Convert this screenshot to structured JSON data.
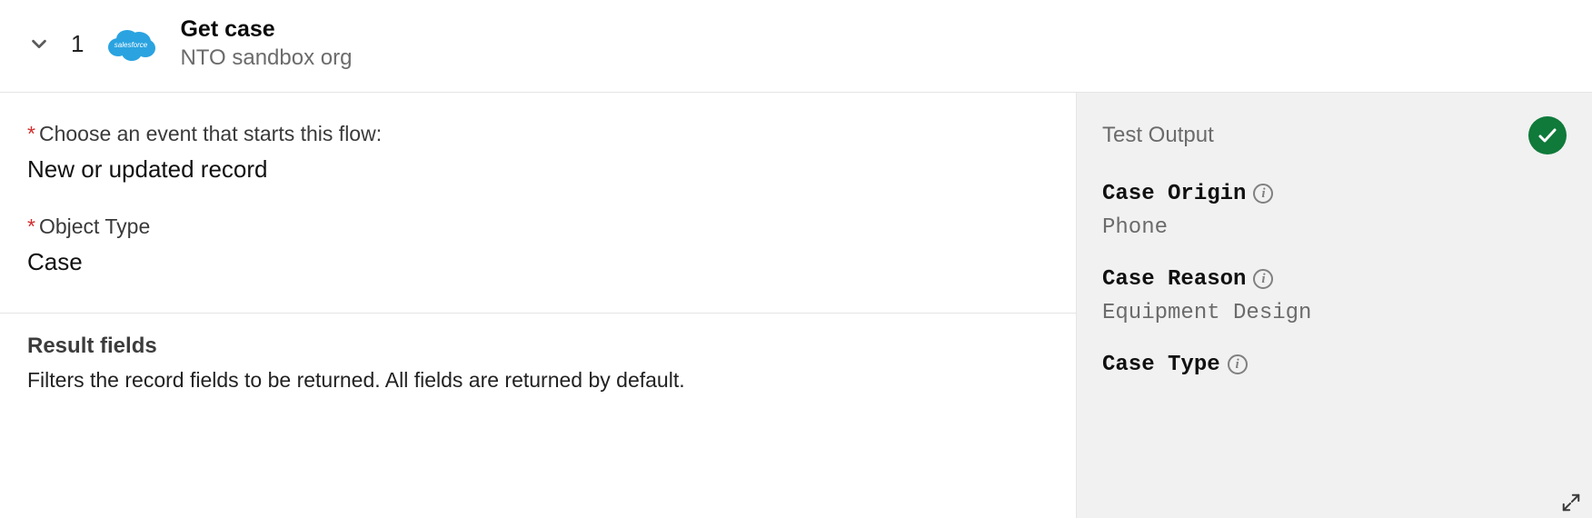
{
  "header": {
    "step_number": "1",
    "title": "Get case",
    "subtitle": "NTO sandbox org",
    "app_icon": "salesforce"
  },
  "form": {
    "event_label": "Choose an event that starts this flow:",
    "event_value": "New or updated record",
    "object_type_label": "Object Type",
    "object_type_value": "Case",
    "result_fields_title": "Result fields",
    "result_fields_desc": "Filters the record fields to be returned. All fields are returned by default."
  },
  "output": {
    "panel_label": "Test Output",
    "status": "success",
    "items": [
      {
        "label": "Case Origin",
        "value": "Phone"
      },
      {
        "label": "Case Reason",
        "value": "Equipment Design"
      },
      {
        "label": "Case Type",
        "value": ""
      }
    ]
  }
}
